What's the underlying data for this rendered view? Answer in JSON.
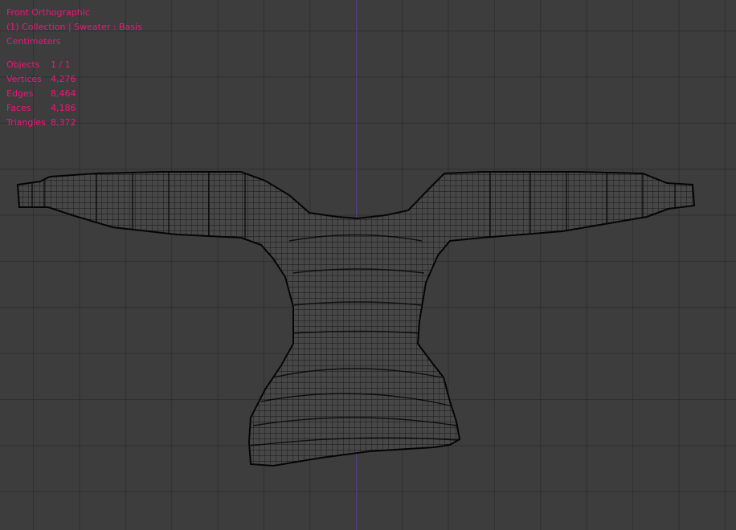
{
  "viewport": {
    "view_name": "Front Orthographic",
    "collection_line": "(1) Collection | Sweater : Basis",
    "units": "Centimeters",
    "stats": [
      {
        "label": "Objects",
        "value": "1 / 1"
      },
      {
        "label": "Vertices",
        "value": "4,276"
      },
      {
        "label": "Edges",
        "value": "8,464"
      },
      {
        "label": "Faces",
        "value": "4,186"
      },
      {
        "label": "Triangles",
        "value": "8,372"
      }
    ],
    "colors": {
      "overlay_text": "#f0157c",
      "background": "#3d3d3d",
      "z_axis": "#5b3f86",
      "wire": "#0a0a0a"
    }
  }
}
